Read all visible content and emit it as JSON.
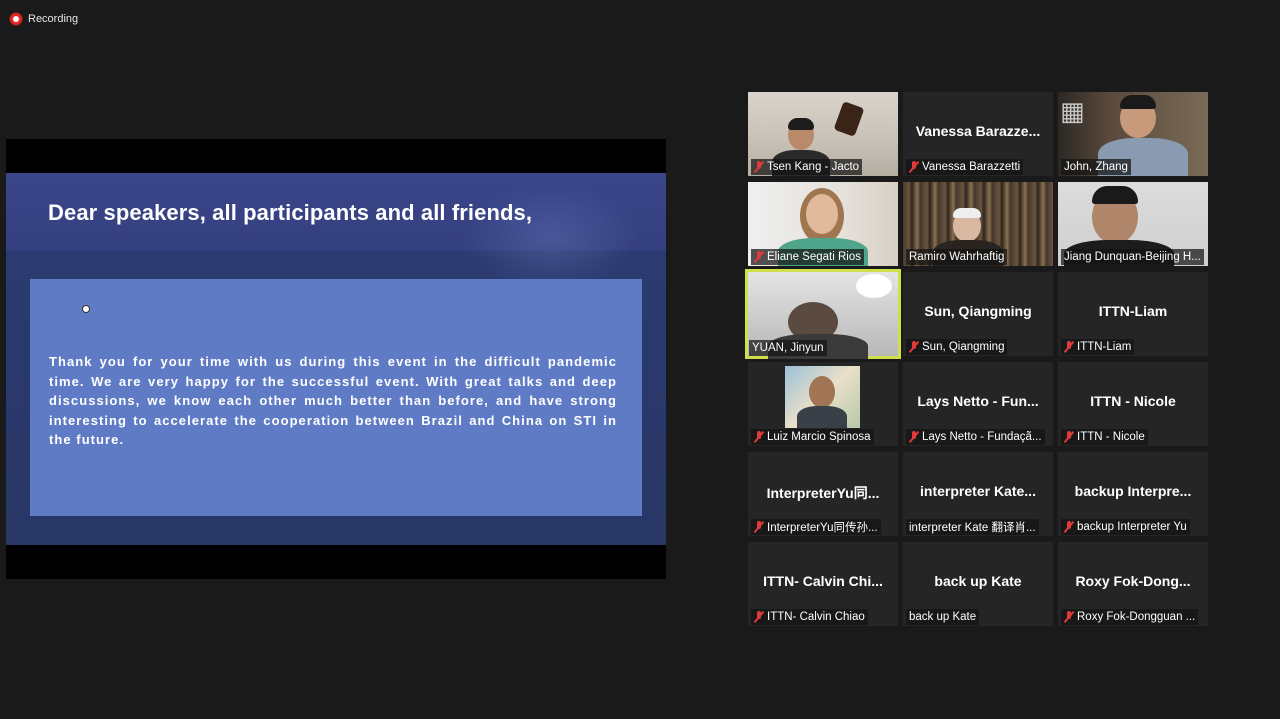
{
  "recording": {
    "label": "Recording"
  },
  "share": {
    "title": "Dear speakers, all participants and all friends,",
    "body": "Thank you for your time with us during this event in the difficult pandemic time. We are very happy for the successful event. With great talks  and deep discussions, we know each other much better than before, and have strong interesting to accelerate  the cooperation between Brazil and China on STI in the future."
  },
  "participants": [
    {
      "label": "Tsen Kang - Jacto",
      "muted": true,
      "video": true
    },
    {
      "big_name": "Vanessa  Barazze...",
      "label": "Vanessa Barazzetti",
      "muted": true,
      "video": false
    },
    {
      "label": "John, Zhang",
      "muted": false,
      "video": true
    },
    {
      "label": "Eliane Segati Rios",
      "muted": true,
      "video": true
    },
    {
      "label": "Ramiro Wahrhaftig",
      "muted": false,
      "video": true
    },
    {
      "label": "Jiang Dunquan-Beijing H...",
      "muted": false,
      "video": true
    },
    {
      "label": "YUAN, Jinyun",
      "muted": false,
      "video": true,
      "active_speaker": true
    },
    {
      "big_name": "Sun, Qiangming",
      "label": "Sun, Qiangming",
      "muted": true,
      "video": false
    },
    {
      "big_name": "ITTN-Liam",
      "label": "ITTN-Liam",
      "muted": true,
      "video": false
    },
    {
      "label": "Luiz Marcio Spinosa",
      "muted": true,
      "video": true
    },
    {
      "big_name": "Lays Netto - Fun...",
      "label": "Lays Netto - Fundaçã...",
      "muted": true,
      "video": false
    },
    {
      "big_name": "ITTN - Nicole",
      "label": "ITTN - Nicole",
      "muted": true,
      "video": false
    },
    {
      "big_name": "InterpreterYu同...",
      "label": "InterpreterYu同传孙...",
      "muted": true,
      "video": false
    },
    {
      "big_name": "interpreter  Kate...",
      "label": "interpreter Kate 翻译肖...",
      "muted": false,
      "video": false
    },
    {
      "big_name": "backup  Interpre...",
      "label": "backup Interpreter Yu",
      "muted": true,
      "video": false
    },
    {
      "big_name": "ITTN-  Calvin  Chi...",
      "label": "ITTN- Calvin Chiao",
      "muted": true,
      "video": false
    },
    {
      "big_name": "back up Kate",
      "label": "back up Kate",
      "muted": false,
      "video": false
    },
    {
      "big_name": "Roxy  Fok-Dong...",
      "label": "Roxy Fok-Dongguan ...",
      "muted": true,
      "video": false
    }
  ]
}
